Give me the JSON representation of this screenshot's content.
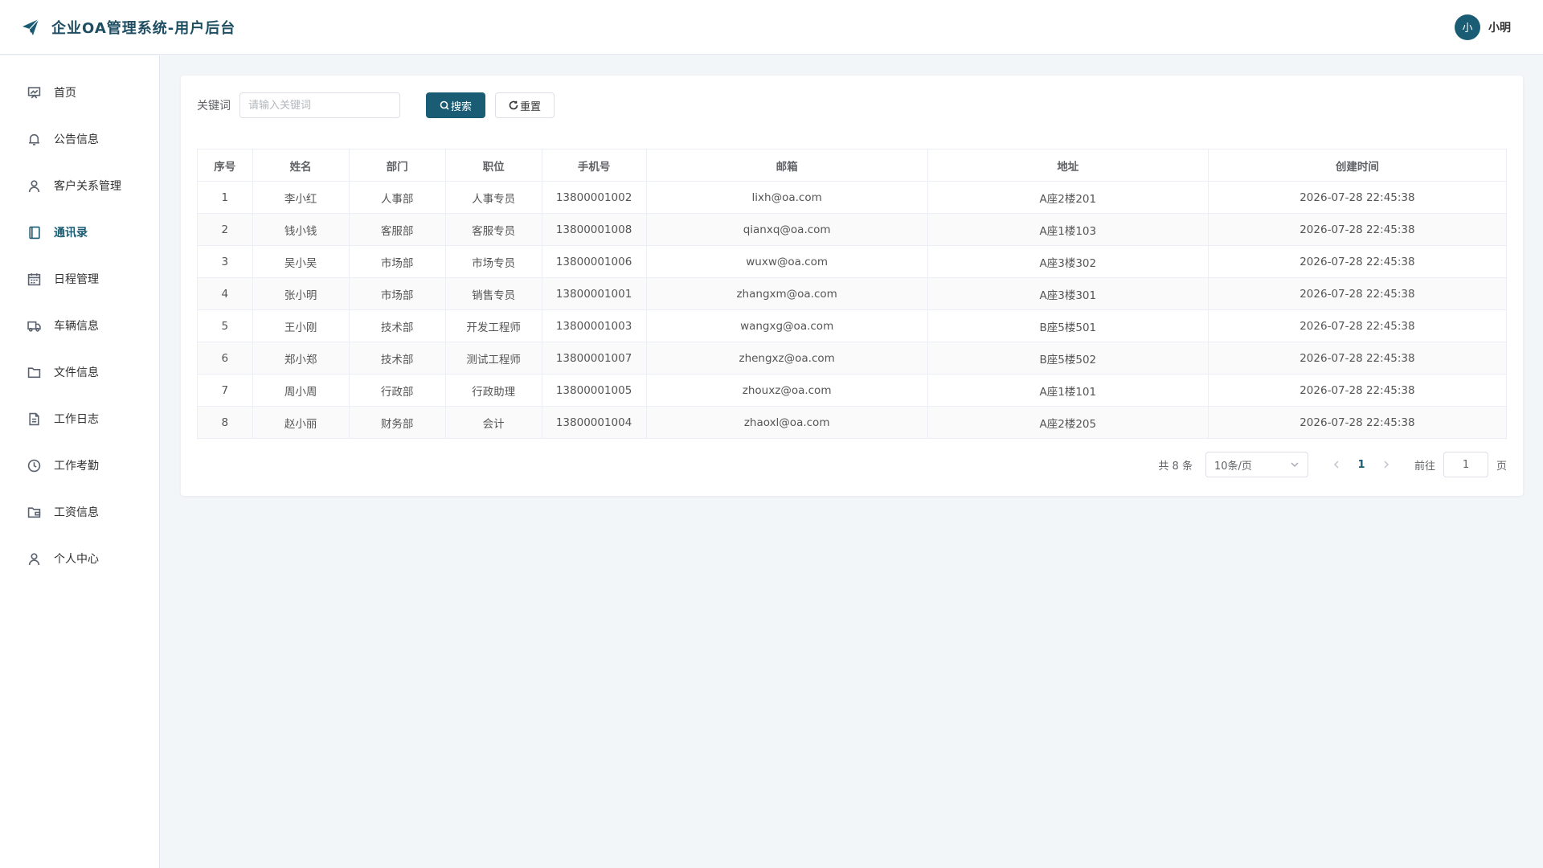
{
  "header": {
    "title": "企业OA管理系统-用户后台",
    "avatar_text": "小",
    "user_name": "小明"
  },
  "sidebar": {
    "items": [
      {
        "label": "首页",
        "icon": "dashboard-icon"
      },
      {
        "label": "公告信息",
        "icon": "bell-icon"
      },
      {
        "label": "客户关系管理",
        "icon": "user-icon"
      },
      {
        "label": "通讯录",
        "icon": "notebook-icon",
        "active": true
      },
      {
        "label": "日程管理",
        "icon": "calendar-icon"
      },
      {
        "label": "车辆信息",
        "icon": "truck-icon"
      },
      {
        "label": "文件信息",
        "icon": "folder-icon"
      },
      {
        "label": "工作日志",
        "icon": "document-icon"
      },
      {
        "label": "工作考勤",
        "icon": "clock-icon"
      },
      {
        "label": "工资信息",
        "icon": "wallet-icon"
      },
      {
        "label": "个人中心",
        "icon": "user-icon"
      }
    ]
  },
  "search": {
    "label": "关键词",
    "placeholder": "请输入关键词",
    "search_label": "搜索",
    "reset_label": "重置"
  },
  "table": {
    "columns": [
      "序号",
      "姓名",
      "部门",
      "职位",
      "手机号",
      "邮箱",
      "地址",
      "创建时间"
    ],
    "rows": [
      [
        "1",
        "李小红",
        "人事部",
        "人事专员",
        "13800001002",
        "lixh@oa.com",
        "A座2楼201",
        "2026-07-28 22:45:38"
      ],
      [
        "2",
        "钱小钱",
        "客服部",
        "客服专员",
        "13800001008",
        "qianxq@oa.com",
        "A座1楼103",
        "2026-07-28 22:45:38"
      ],
      [
        "3",
        "吴小吴",
        "市场部",
        "市场专员",
        "13800001006",
        "wuxw@oa.com",
        "A座3楼302",
        "2026-07-28 22:45:38"
      ],
      [
        "4",
        "张小明",
        "市场部",
        "销售专员",
        "13800001001",
        "zhangxm@oa.com",
        "A座3楼301",
        "2026-07-28 22:45:38"
      ],
      [
        "5",
        "王小刚",
        "技术部",
        "开发工程师",
        "13800001003",
        "wangxg@oa.com",
        "B座5楼501",
        "2026-07-28 22:45:38"
      ],
      [
        "6",
        "郑小郑",
        "技术部",
        "测试工程师",
        "13800001007",
        "zhengxz@oa.com",
        "B座5楼502",
        "2026-07-28 22:45:38"
      ],
      [
        "7",
        "周小周",
        "行政部",
        "行政助理",
        "13800001005",
        "zhouxz@oa.com",
        "A座1楼101",
        "2026-07-28 22:45:38"
      ],
      [
        "8",
        "赵小丽",
        "财务部",
        "会计",
        "13800001004",
        "zhaoxl@oa.com",
        "A座2楼205",
        "2026-07-28 22:45:38"
      ]
    ]
  },
  "pagination": {
    "total_text": "共 8 条",
    "page_size": "10条/页",
    "current_page": "1",
    "goto_label": "前往",
    "goto_value": "1",
    "page_unit": "页"
  },
  "colors": {
    "accent": "#1a5c73"
  }
}
